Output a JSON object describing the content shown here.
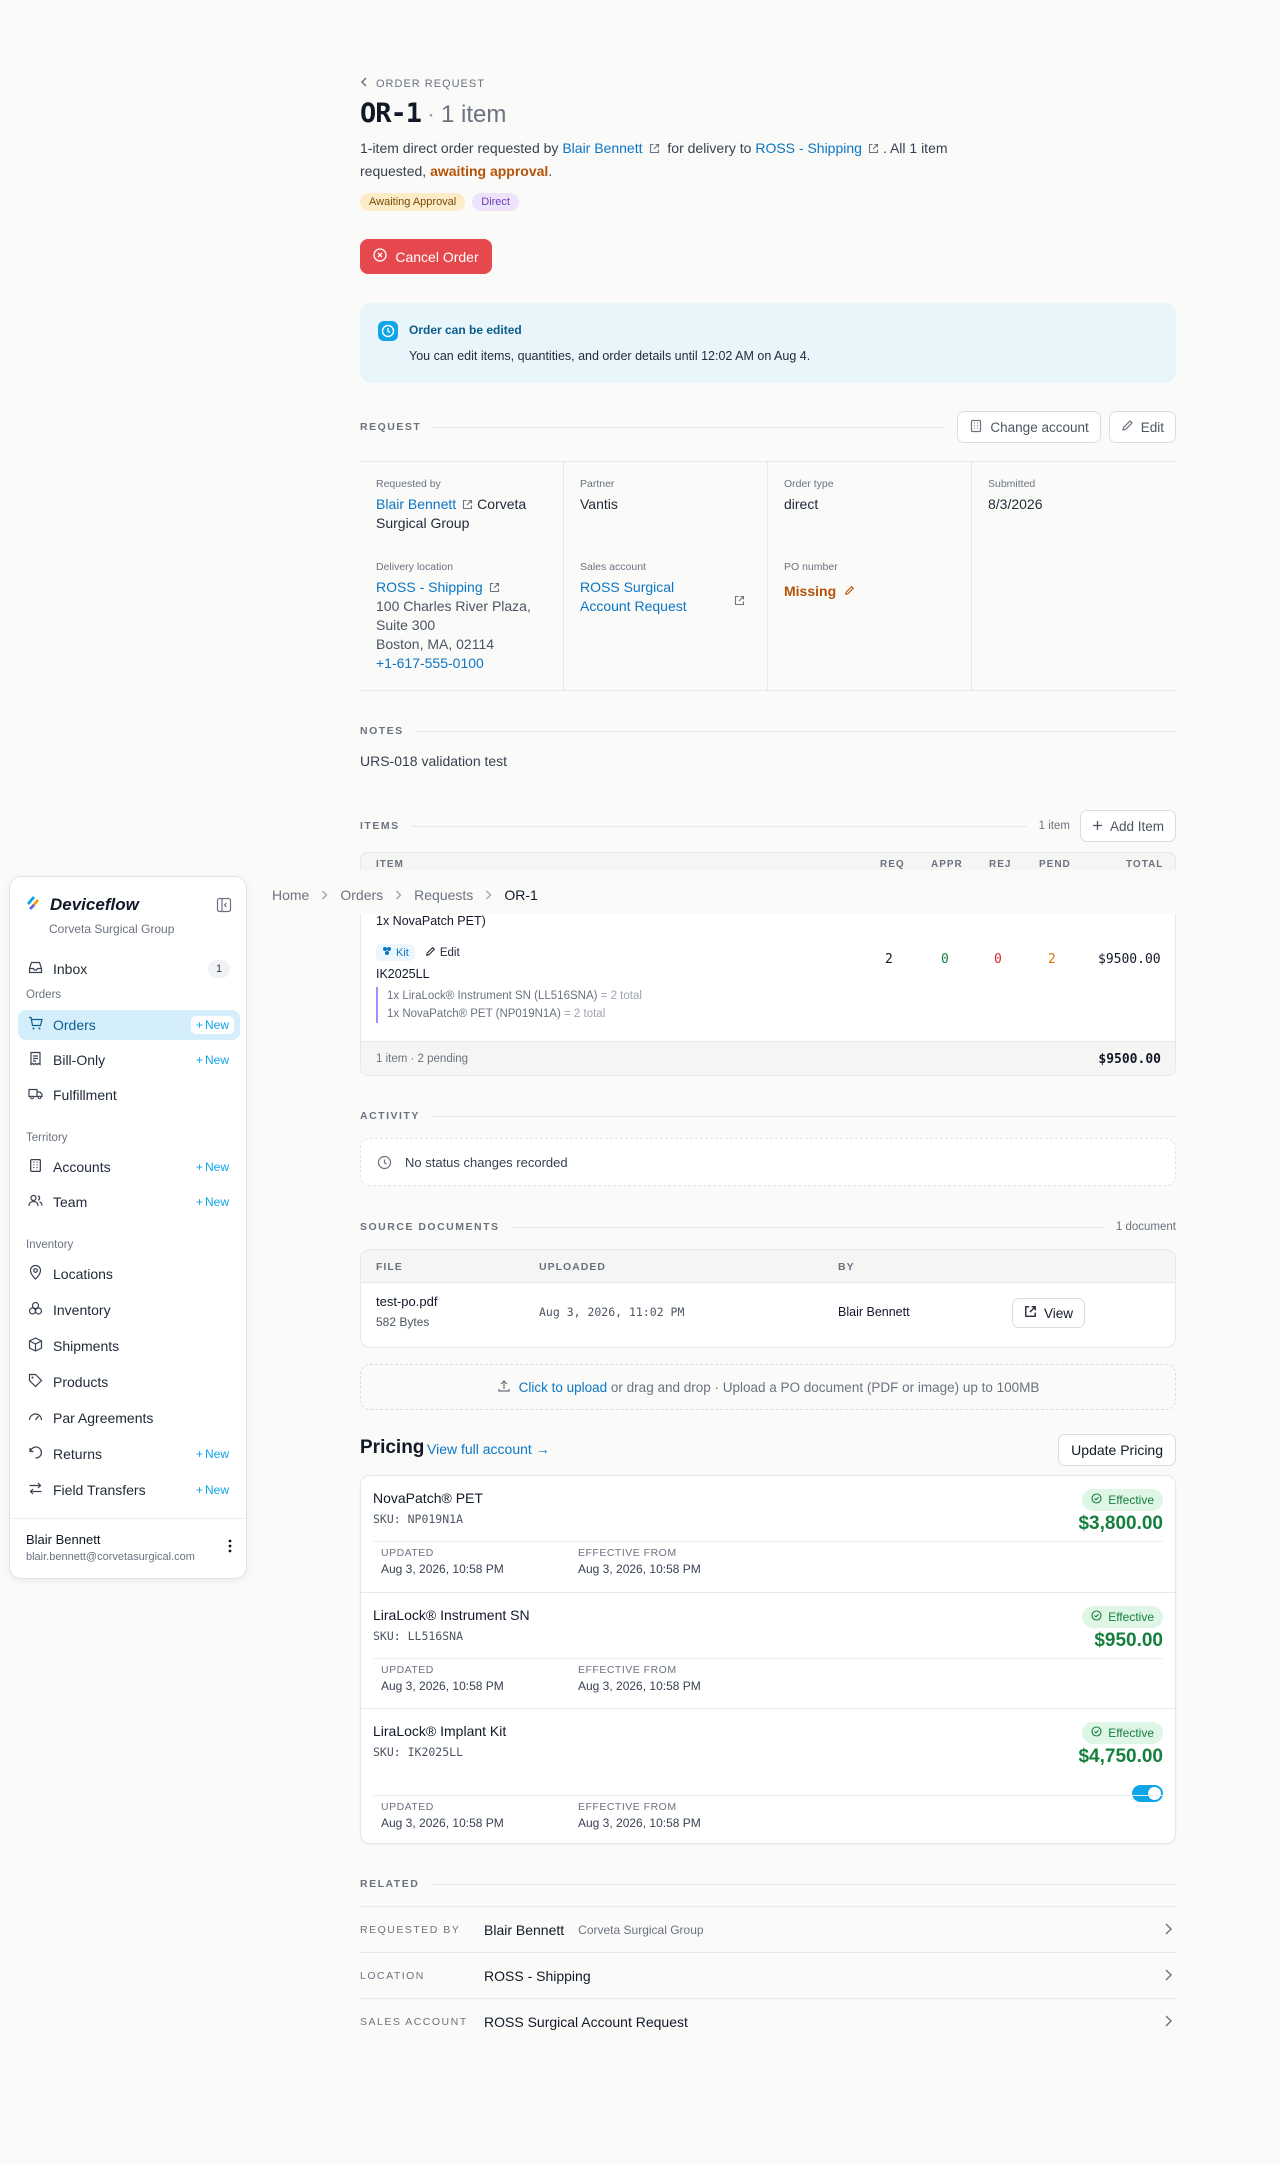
{
  "breadcrumb_top": "ORDER REQUEST",
  "order": {
    "id": "OR-1",
    "dot": "·",
    "item_count": "1 item",
    "summary_pre": "1-item direct order requested by",
    "requester": "Blair Bennett",
    "summary_mid": "for delivery to",
    "delivery": "ROSS - Shipping",
    "summary_post": ". All 1 item requested,",
    "status_text": "awaiting approval",
    "period": "."
  },
  "badges": {
    "status": "Awaiting Approval",
    "type": "Direct"
  },
  "cancel_label": "Cancel Order",
  "notice": {
    "title": "Order can be edited",
    "body": "You can edit items, quantities, and order details until 12:02 AM on Aug 4."
  },
  "request": {
    "heading": "REQUEST",
    "change_account": "Change account",
    "edit": "Edit",
    "requested_by_label": "Requested by",
    "requested_by_name": "Blair Bennett",
    "requested_by_org_1": "Corveta",
    "requested_by_org_2": "Surgical Group",
    "partner_label": "Partner",
    "partner_value": "Vantis",
    "order_type_label": "Order type",
    "order_type_value": "direct",
    "submitted_label": "Submitted",
    "submitted_value": "8/3/2026",
    "delivery_label": "Delivery location",
    "delivery_name": "ROSS - Shipping",
    "addr_1": "100 Charles River Plaza,",
    "addr_2": "Suite 300",
    "addr_3": "Boston, MA, 02114",
    "phone": "+1-617-555-0100",
    "sales_label": "Sales account",
    "sales_1": "ROSS Surgical",
    "sales_2": "Account Request",
    "po_label": "PO number",
    "po_value": "Missing"
  },
  "notes": {
    "heading": "NOTES",
    "text": "URS-018 validation test"
  },
  "items": {
    "heading": "ITEMS",
    "count": "1 item",
    "add": "Add Item",
    "cols": {
      "item": "ITEM",
      "req": "REQ",
      "appr": "APPR",
      "rej": "REJ",
      "pend": "PEND",
      "total": "TOTAL"
    },
    "row": {
      "cut_text": "1x NovaPatch PET)",
      "kit": "Kit",
      "edit": "Edit",
      "sku": "IK2025LL",
      "comp1": "1x LiraLock® Instrument SN (LL516SNA)",
      "comp1_total": "= 2 total",
      "comp2": "1x NovaPatch® PET (NP019N1A)",
      "comp2_total": "= 2 total",
      "req": "2",
      "appr": "0",
      "rej": "0",
      "pend": "2",
      "total": "$9500.00"
    },
    "footer_left": "1 item · 2 pending",
    "footer_total": "$9500.00"
  },
  "activity": {
    "heading": "ACTIVITY",
    "empty": "No status changes recorded"
  },
  "docs": {
    "heading": "SOURCE DOCUMENTS",
    "count": "1 document",
    "cols": {
      "file": "FILE",
      "uploaded": "UPLOADED",
      "by": "BY"
    },
    "file": "test-po.pdf",
    "size": "582 Bytes",
    "uploaded": "Aug 3, 2026, 11:02 PM",
    "by": "Blair Bennett",
    "view": "View"
  },
  "upload": {
    "link": "Click to upload",
    "rest": "or drag and drop · Upload a PO document (PDF or image) up to 100MB"
  },
  "pricing": {
    "title": "Pricing",
    "link": "View full account →",
    "update": "Update Pricing",
    "updated_label": "UPDATED",
    "effective_label": "EFFECTIVE FROM",
    "items": [
      {
        "name": "NovaPatch® PET",
        "sku": "SKU: NP019N1A",
        "status": "Effective",
        "price": "$3,800.00",
        "updated": "Aug 3, 2026, 10:58 PM",
        "effective": "Aug 3, 2026, 10:58 PM"
      },
      {
        "name": "LiraLock® Instrument SN",
        "sku": "SKU: LL516SNA",
        "status": "Effective",
        "price": "$950.00",
        "updated": "Aug 3, 2026, 10:58 PM",
        "effective": "Aug 3, 2026, 10:58 PM"
      },
      {
        "name": "LiraLock® Implant Kit",
        "sku": "SKU: IK2025LL",
        "status": "Effective",
        "price": "$4,750.00",
        "updated": "Aug 3, 2026, 10:58 PM",
        "effective": "Aug 3, 2026, 10:58 PM"
      }
    ]
  },
  "related": {
    "heading": "RELATED",
    "rows": [
      {
        "key": "REQUESTED BY",
        "value": "Blair Bennett",
        "sub": "Corveta Surgical Group"
      },
      {
        "key": "LOCATION",
        "value": "ROSS - Shipping",
        "sub": ""
      },
      {
        "key": "SALES ACCOUNT",
        "value": "ROSS Surgical Account Request",
        "sub": ""
      }
    ]
  },
  "crumbs": [
    "Home",
    "Orders",
    "Requests",
    "OR-1"
  ],
  "sidebar": {
    "brand": "Deviceflow",
    "org": "Corveta Surgical Group",
    "inbox": "Inbox",
    "inbox_count": "1",
    "groups": [
      "Orders",
      "Territory",
      "Inventory"
    ],
    "new_label": "New",
    "items": [
      "Orders",
      "Bill-Only",
      "Fulfillment",
      "Accounts",
      "Team",
      "Locations",
      "Inventory",
      "Shipments",
      "Products",
      "Par Agreements",
      "Returns",
      "Field Transfers"
    ],
    "user_name": "Blair Bennett",
    "user_email": "blair.bennett@corvetasurgical.com"
  },
  "colors": {
    "accent": "#0b76c5",
    "danger": "#e5484d",
    "success": "#15803d",
    "active_nav": "#d5eefb"
  },
  "icons": [
    "chevron-left-icon",
    "external-link-icon",
    "x-circle-icon",
    "clock-icon",
    "building-icon",
    "pencil-icon",
    "plus-icon",
    "kit-icon",
    "upload-icon",
    "check-circle-icon",
    "chevron-right-icon",
    "panel-toggle-icon",
    "inbox-icon",
    "cart-icon",
    "receipt-icon",
    "truck-icon",
    "user-group-icon",
    "map-pin-icon",
    "box-icon",
    "tag-icon",
    "gauge-icon",
    "undo-icon",
    "arrows-icon",
    "dots-vertical-icon"
  ]
}
